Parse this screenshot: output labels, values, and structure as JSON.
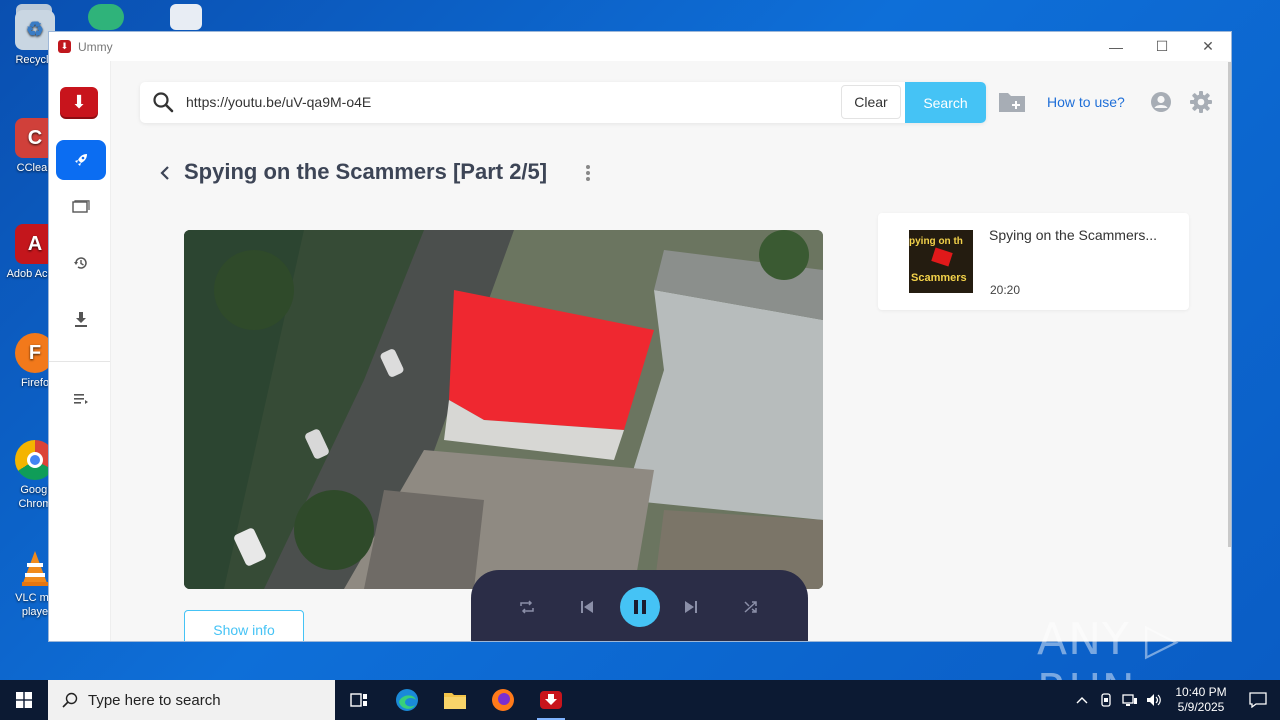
{
  "desktop": {
    "icons": [
      {
        "label": "Recycle",
        "name": "recycle-bin-icon"
      },
      {
        "label": "CClean",
        "name": "ccleaner-icon"
      },
      {
        "label": "Adob Acrob",
        "name": "adobe-acrobat-icon"
      },
      {
        "label": "Firefo",
        "name": "firefox-icon"
      },
      {
        "label": "Googl Chrom",
        "name": "chrome-icon"
      },
      {
        "label": "VLC me playe",
        "name": "vlc-icon"
      }
    ]
  },
  "window": {
    "title": "Ummy",
    "controls": {
      "minimize": "—",
      "maximize": "☐",
      "close": "✕"
    }
  },
  "search": {
    "value": "https://youtu.be/uV-qa9M-o4E",
    "clear_label": "Clear",
    "search_label": "Search"
  },
  "header": {
    "howto_label": "How to use?"
  },
  "video": {
    "title": "Spying on the Scammers [Part 2/5]",
    "show_info_label": "Show info"
  },
  "playlist": {
    "items": [
      {
        "title": "Spying on the Scammers...",
        "duration": "20:20",
        "thumb_text1": "pying on th",
        "thumb_text2": "Scammers"
      }
    ]
  },
  "watermark": "ANY ▷ RUN",
  "taskbar": {
    "search_placeholder": "Type here to search",
    "time": "10:40 PM",
    "date": "5/9/2025"
  },
  "colors": {
    "accent": "#45c3f5",
    "active_nav": "#0b6df2",
    "brand_red": "#c8141c",
    "player_bg": "#2b2d47"
  }
}
